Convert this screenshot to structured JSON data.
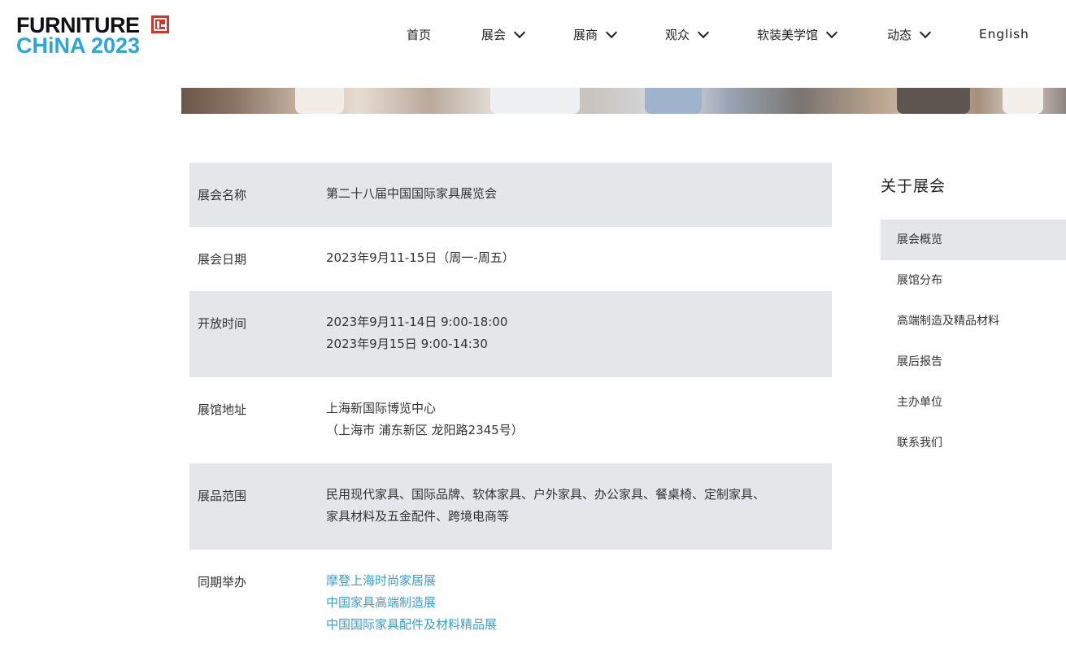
{
  "logo": {
    "line1": "FURNITURE",
    "line2": "CHiNA 2023"
  },
  "nav": {
    "items": [
      {
        "label": "首页",
        "dropdown": false
      },
      {
        "label": "展会",
        "dropdown": true
      },
      {
        "label": "展商",
        "dropdown": true
      },
      {
        "label": "观众",
        "dropdown": true
      },
      {
        "label": "软装美学馆",
        "dropdown": true
      },
      {
        "label": "动态",
        "dropdown": true
      },
      {
        "label": "English",
        "dropdown": false
      }
    ]
  },
  "info": {
    "rows": [
      {
        "label": "展会名称",
        "lines": [
          "第二十八届中国国际家具展览会"
        ]
      },
      {
        "label": "展会日期",
        "lines": [
          "2023年9月11-15日（周一-周五）"
        ]
      },
      {
        "label": "开放时间",
        "lines": [
          "2023年9月11-14日 9:00-18:00",
          "2023年9月15日 9:00-14:30"
        ]
      },
      {
        "label": "展馆地址",
        "lines": [
          "上海新国际博览中心",
          "（上海市 浦东新区 龙阳路2345号）"
        ]
      },
      {
        "label": "展品范围",
        "lines": [
          "民用现代家具、国际品牌、软体家具、户外家具、办公家具、餐桌椅、定制家具、",
          "家具材料及五金配件、跨境电商等"
        ]
      },
      {
        "label": "同期举办",
        "links": [
          "摩登上海时尚家居展",
          "中国家具高端制造展",
          "中国国际家具配件及材料精品展"
        ]
      }
    ]
  },
  "sidebar": {
    "title": "关于展会",
    "items": [
      {
        "label": "展会概览",
        "active": true
      },
      {
        "label": "展馆分布",
        "active": false
      },
      {
        "label": "高端制造及精品材料",
        "active": false
      },
      {
        "label": "展后报告",
        "active": false
      },
      {
        "label": "主办单位",
        "active": false
      },
      {
        "label": "联系我们",
        "active": false
      }
    ]
  },
  "colors": {
    "brand_blue": "#2aa6d9",
    "logo_red": "#d2342c",
    "row_shade": "#e5e6ea",
    "link": "#3a9fcf"
  }
}
